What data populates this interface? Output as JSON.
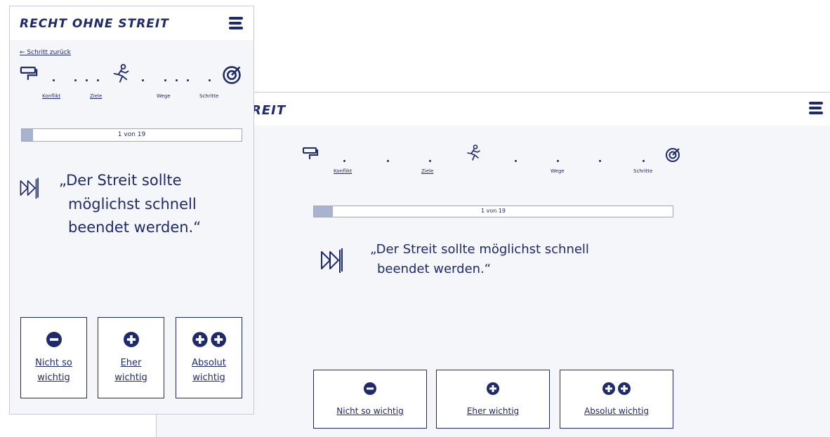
{
  "brand": "RECHT OHNE STREIT",
  "brand_desktop_partial": "REIT",
  "nav": {
    "back_label": "← Schritt zurück"
  },
  "stepper": {
    "steps": [
      "Konflikt",
      "Ziele",
      "Wege",
      "Schritte"
    ],
    "icons": [
      "paint-roller-icon",
      "runner-icon",
      "target-icon"
    ]
  },
  "progress": {
    "text": "1 von 19",
    "current": 1,
    "total": 19
  },
  "question": {
    "mobile_lines": [
      "„Der Streit sollte",
      "möglichst schnell",
      "beendet werden.“"
    ],
    "desktop_lines": [
      "„Der Streit sollte möglichst schnell",
      "beendet werden.“"
    ]
  },
  "answers_mobile": [
    {
      "line1": "Nicht so",
      "line2": "wichtig",
      "icon": "minus-circle-icon"
    },
    {
      "line1": "Eher",
      "line2": "wichtig",
      "icon": "plus-circle-icon"
    },
    {
      "line1": "Absolut",
      "line2": "wichtig",
      "icon": "double-plus-circle-icon"
    }
  ],
  "answers_desktop": [
    {
      "label": "Nicht so wichtig",
      "icon": "minus-circle-icon"
    },
    {
      "label": "Eher wichtig",
      "icon": "plus-circle-icon"
    },
    {
      "label": "Absolut wichtig",
      "icon": "double-plus-circle-icon"
    }
  ],
  "colors": {
    "navy": "#1f2a6b",
    "background": "#f4f6f9",
    "progress_fill": "#a9b3cf"
  }
}
